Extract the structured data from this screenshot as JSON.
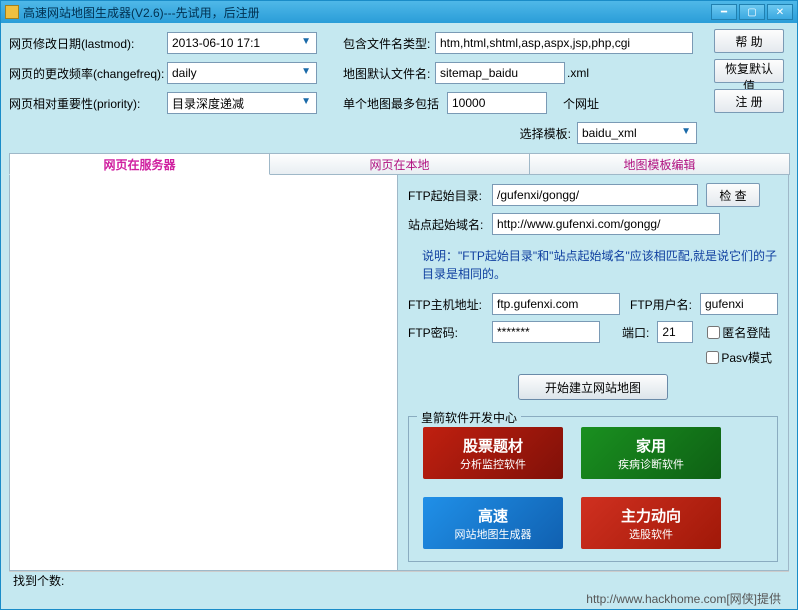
{
  "titlebar": {
    "title": "高速网站地图生成器(V2.6)---先试用，后注册"
  },
  "form": {
    "lastmod_label": "网页修改日期(lastmod):",
    "lastmod_value": "2013-06-10 17:1",
    "changefreq_label": "网页的更改频率(changefreq):",
    "changefreq_value": "daily",
    "priority_label": "网页相对重要性(priority):",
    "priority_value": "目录深度递减",
    "include_ext_label": "包含文件名类型:",
    "include_ext_value": "htm,html,shtml,asp,aspx,jsp,php,cgi",
    "default_filename_label": "地图默认文件名:",
    "default_filename_value": "sitemap_baidu",
    "default_filename_suffix": ".xml",
    "max_label": "单个地图最多包括",
    "max_value": "10000",
    "max_suffix": "个网址",
    "template_label": "选择模板:",
    "template_value": "baidu_xml"
  },
  "buttons": {
    "help": "帮 助",
    "restore": "恢复默认值",
    "register": "注 册",
    "check": "检 查",
    "start": "开始建立网站地图"
  },
  "tabs": {
    "t1": "网页在服务器",
    "t2": "网页在本地",
    "t3": "地图模板编辑"
  },
  "ftp": {
    "start_dir_label": "FTP起始目录:",
    "start_dir_value": "/gufenxi/gongg/",
    "site_domain_label": "站点起始域名:",
    "site_domain_value": "http://www.gufenxi.com/gongg/",
    "note": "说明：\"FTP起始目录\"和\"站点起始域名\"应该相匹配,就是说它们的子目录是相同的。",
    "host_label": "FTP主机地址:",
    "host_value": "ftp.gufenxi.com",
    "user_label": "FTP用户名:",
    "user_value": "gufenxi",
    "pwd_label": "FTP密码:",
    "pwd_value": "*******",
    "port_label": "端口:",
    "port_value": "21",
    "anon_label": "匿名登陆",
    "pasv_label": "Pasv模式"
  },
  "group_title": "皇箭软件开发中心",
  "promos": {
    "a1": "股票题材",
    "a2": "分析监控软件",
    "b1": "家用",
    "b2": "疾病诊断软件",
    "c1": "高速",
    "c2": "网站地图生成器",
    "d1": "主力动向",
    "d2": "选股软件"
  },
  "leftfoot": "找到个数:",
  "footer": "http://www.hackhome.com[网侠]提供"
}
